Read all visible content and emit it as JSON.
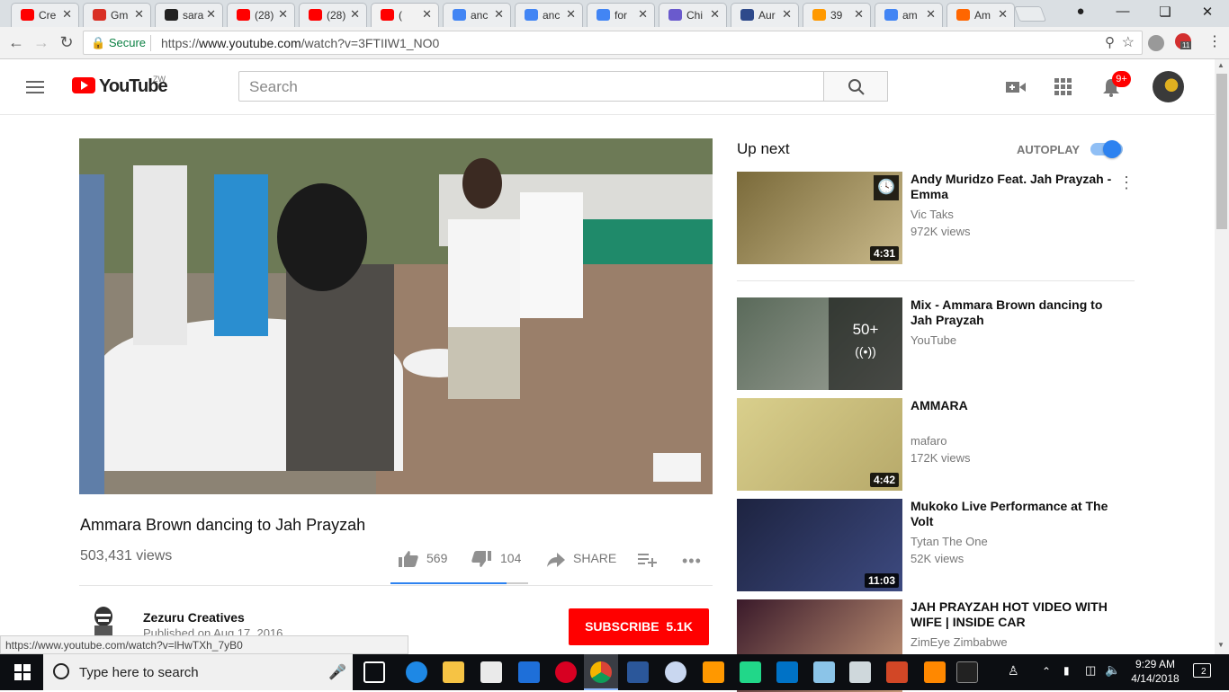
{
  "browser": {
    "tabs": [
      {
        "label": "Cre",
        "icon": "youtube-icon",
        "color": "#ff0000"
      },
      {
        "label": "Gm",
        "icon": "gmail-icon",
        "color": "#d93025"
      },
      {
        "label": "sara",
        "icon": "github-icon",
        "color": "#222222"
      },
      {
        "label": "(28)",
        "icon": "youtube-icon",
        "color": "#ff0000"
      },
      {
        "label": "(28)",
        "icon": "youtube-icon",
        "color": "#ff0000"
      },
      {
        "label": "(",
        "icon": "youtube-icon",
        "color": "#ff0000",
        "active": true
      },
      {
        "label": "anc",
        "icon": "google-icon",
        "color": "#4285f4"
      },
      {
        "label": "anc",
        "icon": "google-icon",
        "color": "#4285f4"
      },
      {
        "label": "for",
        "icon": "google-icon",
        "color": "#4285f4"
      },
      {
        "label": "Chi",
        "icon": "guitar-icon",
        "color": "#6a5acd"
      },
      {
        "label": "Aur",
        "icon": "s-logo-icon",
        "color": "#2e4a8b"
      },
      {
        "label": "39",
        "icon": "her-logo-icon",
        "color": "#ff9900"
      },
      {
        "label": "am",
        "icon": "google-icon",
        "color": "#4285f4"
      },
      {
        "label": "Am",
        "icon": "fire-icon",
        "color": "#ff6600"
      }
    ],
    "secure_label": "Secure",
    "url_prefix": "https://",
    "url_host": "www.youtube.com",
    "url_path": "/watch?v=3FTIIW1_NO0",
    "ext_badge": "11",
    "status_url": "https://www.youtube.com/watch?v=lHwTXh_7yB0"
  },
  "youtube": {
    "logo_text": "YouTube",
    "region": "ZW",
    "search_placeholder": "Search",
    "notif_count": "9+"
  },
  "video": {
    "title": "Ammara Brown dancing to Jah Prayzah",
    "views": "503,431 views",
    "likes": "569",
    "dislikes": "104",
    "share_label": "SHARE",
    "like_ratio": 0.845,
    "channel": "Zezuru Creatives",
    "published": "Published on Aug 17, 2016",
    "subscribe_label": "SUBSCRIBE",
    "subscriber_count": "5.1K"
  },
  "sidebar": {
    "up_next": "Up next",
    "autoplay": "AUTOPLAY",
    "autoplay_on": true,
    "items": [
      {
        "title": "Andy Muridzo Feat. Jah Prayzah - Emma",
        "channel": "Vic Taks",
        "views": "972K views",
        "duration": "4:31",
        "colors": [
          "#7a6a3a",
          "#c9b98a"
        ]
      },
      {
        "title": "Mix - Ammara Brown dancing to Jah Prayzah",
        "channel": "YouTube",
        "views": "",
        "mix_count": "50+",
        "colors": [
          "#5a6a5a",
          "#9fa39a"
        ]
      },
      {
        "title": "AMMARA",
        "channel": "mafaro",
        "views": "172K views",
        "duration": "4:42",
        "colors": [
          "#d9cf8c",
          "#b7a96a"
        ]
      },
      {
        "title": "Mukoko Live Performance at The Volt",
        "channel": "Tytan The One",
        "views": "52K views",
        "duration": "11:03",
        "colors": [
          "#1d2340",
          "#3d4a80"
        ]
      },
      {
        "title": "JAH PRAYZAH HOT VIDEO WITH WIFE | INSIDE CAR",
        "channel": "ZimEye Zimbabwe",
        "views": "",
        "duration": "",
        "colors": [
          "#3a1a2a",
          "#c89a7a"
        ]
      }
    ]
  },
  "taskbar": {
    "search_placeholder": "Type here to search",
    "time": "9:29 AM",
    "date": "4/14/2018",
    "notif_count": "2"
  }
}
